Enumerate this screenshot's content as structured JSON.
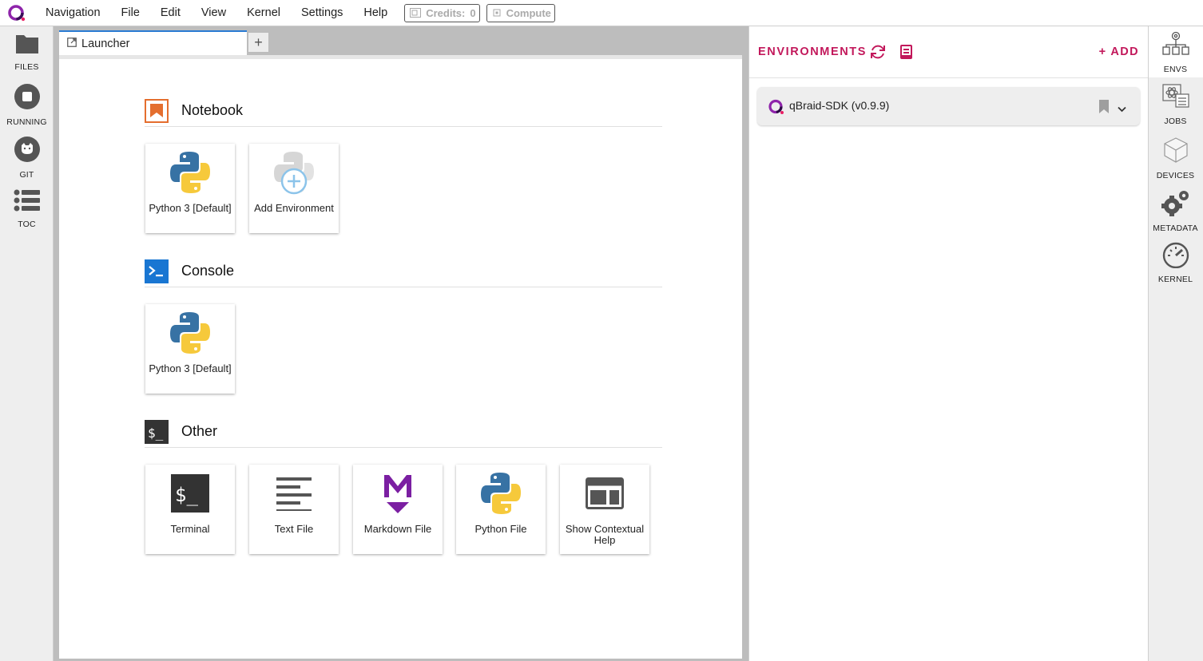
{
  "menubar": {
    "items": [
      "Navigation",
      "File",
      "Edit",
      "View",
      "Kernel",
      "Settings",
      "Help"
    ],
    "credits_label": "Credits:",
    "credits_value": "0",
    "compute_label": "Compute"
  },
  "left_sidebar": {
    "items": [
      {
        "label": "FILES",
        "icon": "folder-icon"
      },
      {
        "label": "RUNNING",
        "icon": "stop-circle-icon"
      },
      {
        "label": "GIT",
        "icon": "github-icon"
      },
      {
        "label": "TOC",
        "icon": "list-icon"
      }
    ]
  },
  "tabs": {
    "active": {
      "label": "Launcher",
      "icon": "launcher-icon"
    },
    "new_tab_label": "+"
  },
  "launcher": {
    "sections": [
      {
        "title": "Notebook",
        "icon": "notebook-icon",
        "cards": [
          {
            "label": "Python 3 [Default]",
            "icon": "python-logo-icon"
          },
          {
            "label": "Add Environment",
            "icon": "add-environment-icon"
          }
        ]
      },
      {
        "title": "Console",
        "icon": "console-icon",
        "cards": [
          {
            "label": "Python 3 [Default]",
            "icon": "python-logo-icon"
          }
        ]
      },
      {
        "title": "Other",
        "icon": "terminal-icon",
        "cards": [
          {
            "label": "Terminal",
            "icon": "terminal-icon"
          },
          {
            "label": "Text File",
            "icon": "text-file-icon"
          },
          {
            "label": "Markdown File",
            "icon": "markdown-icon"
          },
          {
            "label": "Python File",
            "icon": "python-logo-icon"
          },
          {
            "label": "Show Contextual Help",
            "icon": "contextual-help-icon"
          }
        ]
      }
    ]
  },
  "environments": {
    "title": "ENVIRONMENTS",
    "add_label": "+ ADD",
    "items": [
      {
        "name": "qBraid-SDK (v0.9.9)"
      }
    ]
  },
  "right_sidebar": {
    "items": [
      {
        "label": "ENVS",
        "icon": "envs-icon"
      },
      {
        "label": "JOBS",
        "icon": "jobs-icon"
      },
      {
        "label": "DEVICES",
        "icon": "devices-icon"
      },
      {
        "label": "METADATA",
        "icon": "gears-icon"
      },
      {
        "label": "KERNEL",
        "icon": "gauge-icon"
      }
    ]
  },
  "colors": {
    "accent": "#c2185b",
    "brand_purple": "#7b1fa2",
    "tab_active": "#2a7bd3",
    "notebook_orange": "#e46e2e",
    "console_blue": "#1976d2"
  }
}
